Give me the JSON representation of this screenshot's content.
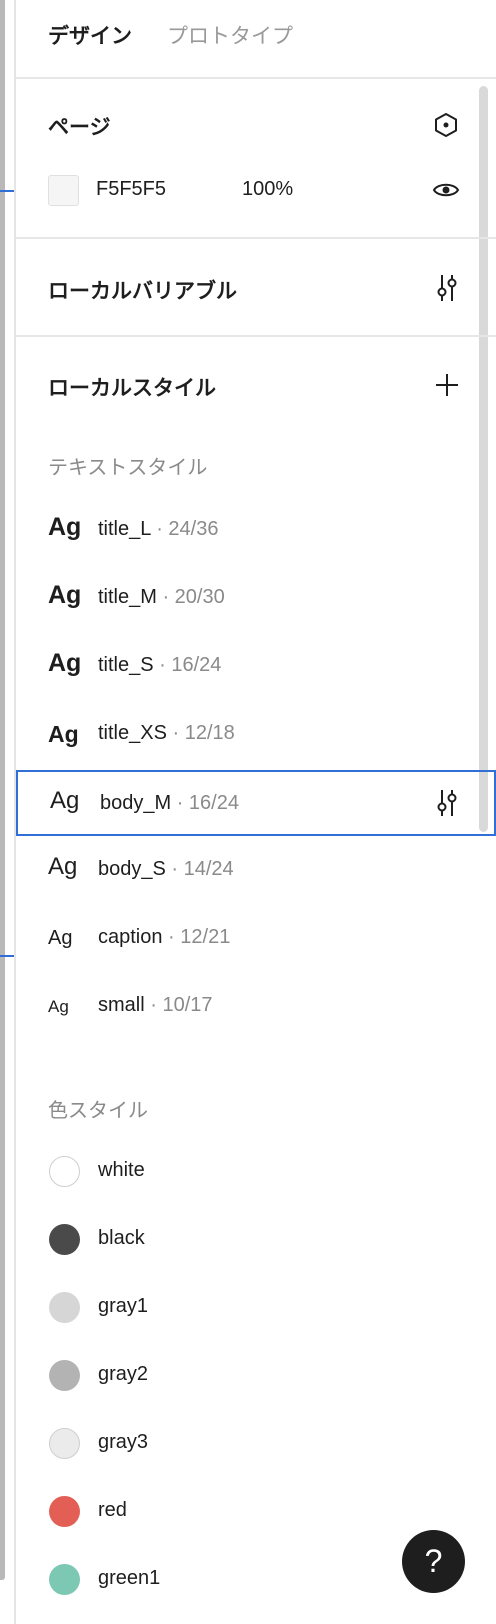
{
  "tabs": {
    "design": "デザイン",
    "prototype": "プロトタイプ"
  },
  "page": {
    "title": "ページ",
    "fill": {
      "hex": "F5F5F5",
      "opacity": "100%",
      "color": "#F5F5F5"
    }
  },
  "variables": {
    "title": "ローカルバリアブル"
  },
  "styles": {
    "title": "ローカルスタイル",
    "text_heading": "テキストスタイル",
    "text_styles": [
      {
        "sample": "Ag",
        "name": "title_L",
        "meta": " · 24/36",
        "weight": "bold",
        "selected": false
      },
      {
        "sample": "Ag",
        "name": "title_M",
        "meta": " · 20/30",
        "weight": "bold",
        "selected": false
      },
      {
        "sample": "Ag",
        "name": "title_S",
        "meta": " · 16/24",
        "weight": "bold",
        "selected": false
      },
      {
        "sample": "Ag",
        "name": "title_XS",
        "meta": " · 12/18",
        "weight": "bold",
        "selected": false
      },
      {
        "sample": "Ag",
        "name": "body_M",
        "meta": " · 16/24",
        "weight": "normal",
        "selected": true
      },
      {
        "sample": "Ag",
        "name": "body_S",
        "meta": " · 14/24",
        "weight": "normal",
        "selected": false
      },
      {
        "sample": "Ag",
        "name": "caption",
        "meta": " · 12/21",
        "weight": "normal",
        "selected": false
      },
      {
        "sample": "Ag",
        "name": "small",
        "meta": " · 10/17",
        "weight": "normal",
        "selected": false
      }
    ],
    "color_heading": "色スタイル",
    "color_styles": [
      {
        "name": "white",
        "color": "#FFFFFF"
      },
      {
        "name": "black",
        "color": "#4A4A4A"
      },
      {
        "name": "gray1",
        "color": "#D6D6D6"
      },
      {
        "name": "gray2",
        "color": "#B3B3B3"
      },
      {
        "name": "gray3",
        "color": "#EBEBEB"
      },
      {
        "name": "red",
        "color": "#E35F55"
      },
      {
        "name": "green1",
        "color": "#7CC8B3"
      }
    ]
  },
  "help": {
    "label": "?"
  },
  "colors": {
    "accent": "#2F6FD6",
    "selection_border": "#2F6FD6"
  }
}
